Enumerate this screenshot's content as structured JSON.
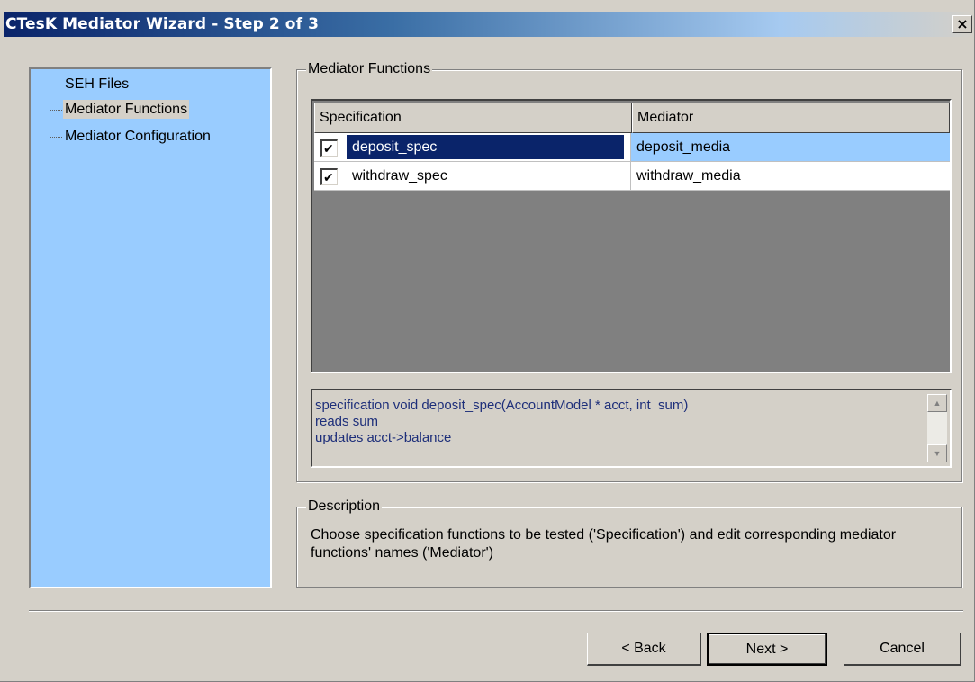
{
  "window": {
    "title": "CTesK Mediator Wizard - Step 2 of 3",
    "close_label": "×"
  },
  "tree": {
    "items": [
      {
        "label": "SEH Files",
        "selected": false
      },
      {
        "label": "Mediator Functions",
        "selected": true
      },
      {
        "label": "Mediator Configuration",
        "selected": false
      }
    ]
  },
  "mediator_functions": {
    "group_title": "Mediator Functions",
    "columns": [
      "Specification",
      "Mediator"
    ],
    "rows": [
      {
        "checked": true,
        "checkmark": "✔",
        "specification": "deposit_spec",
        "mediator": "deposit_media",
        "selected": true
      },
      {
        "checked": true,
        "checkmark": "✔",
        "specification": "withdraw_spec",
        "mediator": "withdraw_media",
        "selected": false
      }
    ],
    "code_lines": [
      "specification void deposit_spec(AccountModel * acct, int  sum)",
      "reads sum",
      "updates acct->balance"
    ],
    "scroll_up_glyph": "▲",
    "scroll_down_glyph": "▼"
  },
  "description": {
    "group_title": "Description",
    "text": "Choose specification functions to be tested ('Specification') and edit corresponding mediator functions' names ('Mediator')"
  },
  "buttons": {
    "back": "< Back",
    "next": "Next >",
    "cancel": "Cancel"
  },
  "colors": {
    "window_bg": "#d4d0c8",
    "tree_bg": "#99ccff",
    "selected_row_bg": "#99ccff",
    "selected_cell_bg": "#0a246a",
    "code_text": "#1e2f7a"
  }
}
